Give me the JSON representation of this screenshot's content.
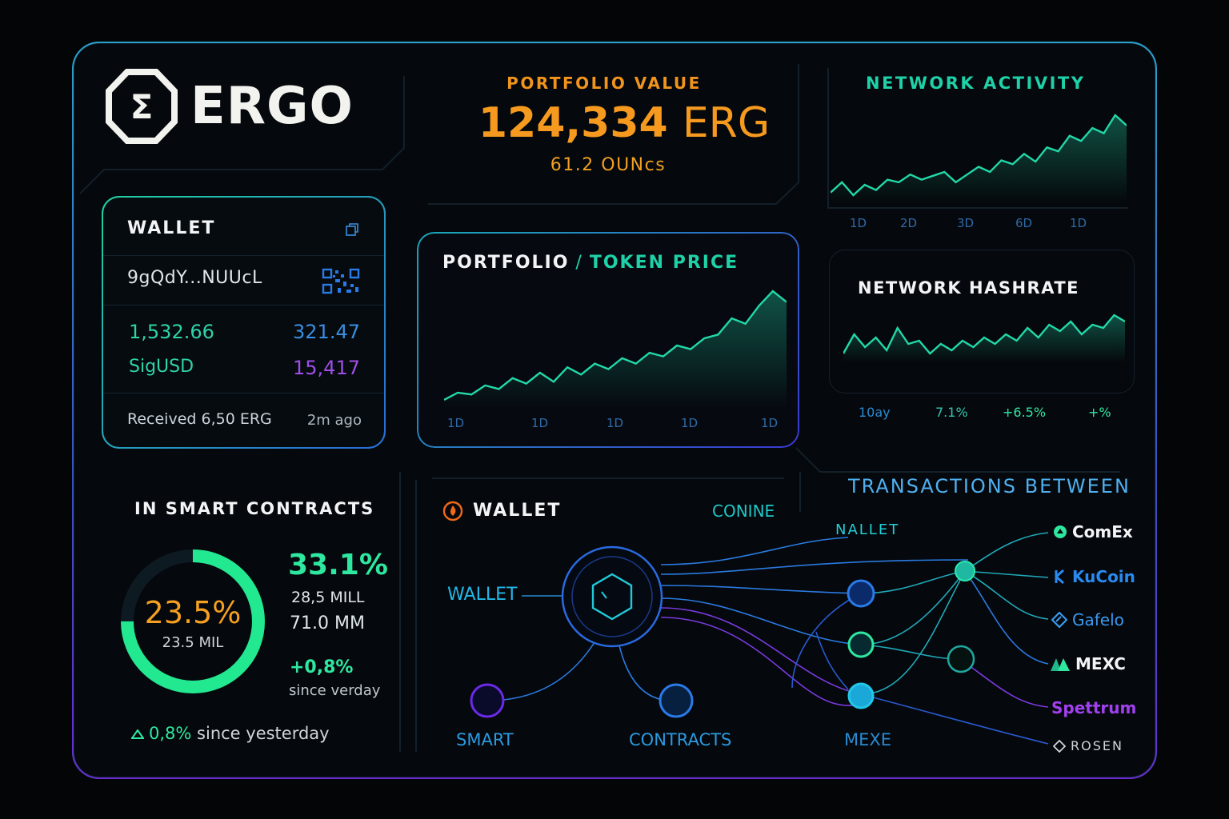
{
  "brand": {
    "name": "ERGO"
  },
  "portfolio": {
    "title": "PORTFOLIO VALUE",
    "value": "124,334",
    "unit": "ERG",
    "sub": "61.2 OUNcs"
  },
  "wallet": {
    "title": "WALLET",
    "address": "9gQdY...NUUcL",
    "balance_primary": "1,532.66",
    "balance_secondary": "321.47",
    "token_name": "SigUSD",
    "token_value": "15,417",
    "received": "Received 6,50 ERG",
    "received_time": "2m ago"
  },
  "price_chart": {
    "title_left": "PORTFOLIO",
    "separator": "/",
    "title_right": "TOKEN PRICE",
    "x_ticks": [
      "1D",
      "1D",
      "1D",
      "1D",
      "1D"
    ]
  },
  "network_activity": {
    "title": "NETWORK ACTIVITY",
    "x_ticks": [
      "1D",
      "2D",
      "3D",
      "6D",
      "1D"
    ]
  },
  "network_hashrate": {
    "title": "NETWORK HASHRATE",
    "stats": [
      "10ay",
      "7.1%",
      "+6.5%",
      "+%"
    ]
  },
  "smart_contracts": {
    "title": "IN SMART CONTRACTS",
    "gauge_pct": "23.5%",
    "gauge_fraction": 0.75,
    "gauge_sub": "23.5 MIL",
    "big_pct": "33.1%",
    "line1": "28,5 MILL",
    "line2": "71.0 MM",
    "change": "+0,8%",
    "since": "since verday",
    "footer_pct": "0,8%",
    "footer_text": "since yesterday"
  },
  "wallet_flow": {
    "title": "WALLET",
    "coin": "CONINE",
    "node_wallet": "WALLET",
    "node_smart": "SMART",
    "node_contracts": "CONTRACTS"
  },
  "transactions": {
    "title": "TRANSACTIONS BETWEEN",
    "nallet": "NALLET",
    "mexe": "MEXE",
    "exchanges": [
      {
        "name": "ComEx",
        "color": "#f2f4f6",
        "icon": "comex-icon"
      },
      {
        "name": "KuCoin",
        "color": "#2a8af0",
        "icon": "kucoin-icon"
      },
      {
        "name": "Gafelo",
        "color": "#3a9af0",
        "icon": "gafelo-icon"
      },
      {
        "name": "MEXC",
        "color": "#f2f4f6",
        "icon": "mexc-icon"
      },
      {
        "name": "Spettrum",
        "color": "#a040f0",
        "icon": ""
      },
      {
        "name": "ROSEN",
        "color": "#cfd6da",
        "icon": "rosen-icon"
      }
    ]
  },
  "colors": {
    "accent_orange": "#f59a1f",
    "accent_green": "#2ee8a0",
    "accent_blue": "#2f6aa8",
    "accent_purple": "#a04ee8"
  },
  "chart_data": [
    {
      "type": "line",
      "title": "PORTFOLIO / TOKEN PRICE",
      "x": [
        "1D",
        "1D",
        "1D",
        "1D",
        "1D"
      ],
      "series": [
        {
          "values": [
            10,
            14,
            13,
            18,
            16,
            22,
            19,
            25,
            20,
            28,
            24,
            30,
            27,
            33,
            30,
            36,
            34,
            40,
            38,
            44,
            46,
            55,
            52,
            62,
            70,
            64
          ]
        }
      ]
    },
    {
      "type": "line",
      "title": "NETWORK ACTIVITY",
      "x": [
        "1D",
        "2D",
        "3D",
        "6D",
        "1D"
      ],
      "series": [
        {
          "values": [
            20,
            28,
            18,
            26,
            22,
            30,
            28,
            34,
            30,
            33,
            36,
            28,
            34,
            40,
            36,
            45,
            42,
            50,
            44,
            55,
            52,
            64,
            60,
            70,
            66,
            80,
            72
          ]
        }
      ]
    },
    {
      "type": "line",
      "title": "NETWORK HASHRATE",
      "x": [
        "10ay",
        "7.1%",
        "+6.5%",
        "+%"
      ],
      "series": [
        {
          "values": [
            30,
            42,
            34,
            40,
            32,
            46,
            36,
            38,
            30,
            36,
            32,
            38,
            34,
            40,
            36,
            42,
            38,
            46,
            40,
            48,
            44,
            50,
            42,
            48,
            46,
            54,
            50
          ]
        }
      ]
    }
  ]
}
